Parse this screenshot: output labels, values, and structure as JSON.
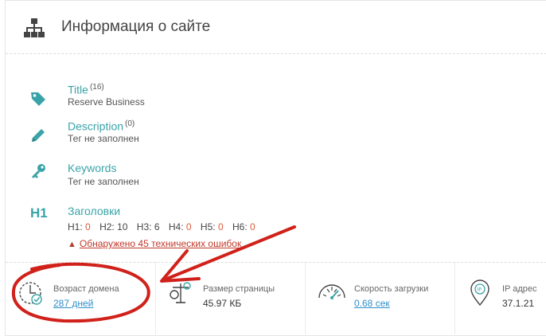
{
  "header": {
    "title": "Информация о сайте",
    "icon": "sitemap-icon"
  },
  "meta": {
    "title": {
      "label": "Title",
      "count": "(16)",
      "value": "Reserve Business",
      "icon": "tag-icon"
    },
    "description": {
      "label": "Description",
      "count": "(0)",
      "value": "Тег не заполнен",
      "icon": "pencil-icon"
    },
    "keywords": {
      "label": "Keywords",
      "value": "Тег не заполнен",
      "icon": "key-icon"
    },
    "headings": {
      "label": "Заголовки",
      "icon_text": "H1",
      "counts": [
        {
          "name": "H1:",
          "value": "0"
        },
        {
          "name": "H2:",
          "value": "10"
        },
        {
          "name": "H3:",
          "value": "6"
        },
        {
          "name": "H4:",
          "value": "0"
        },
        {
          "name": "H5:",
          "value": "0"
        },
        {
          "name": "H6:",
          "value": "0"
        }
      ],
      "warning": "Обнаружено 45 технических ошибок"
    }
  },
  "stats": [
    {
      "label": "Возраст домена",
      "value": "287 дней",
      "icon": "domain-age-icon"
    },
    {
      "label": "Размер страницы",
      "value": "45.97 КБ",
      "icon": "page-size-icon"
    },
    {
      "label": "Скорость загрузки",
      "value": "0.68 сек",
      "icon": "speedometer-icon"
    },
    {
      "label": "IP адрес",
      "value": "37.1.21",
      "icon": "ip-location-icon"
    }
  ],
  "colors": {
    "accent": "#3aa3a8",
    "link": "#2f8fc9",
    "error": "#c0392b",
    "annotation": "#d0211a"
  }
}
